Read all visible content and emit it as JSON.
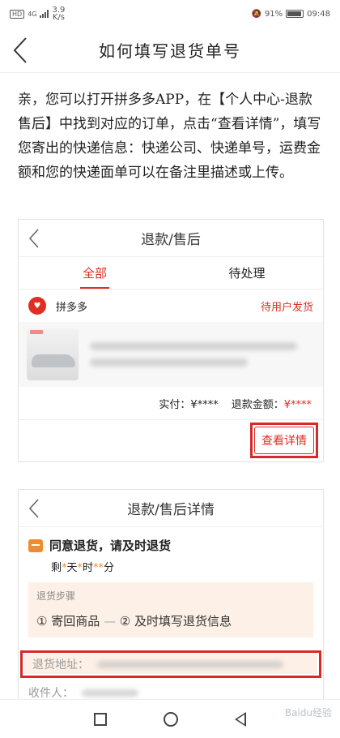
{
  "status_bar": {
    "network": "HD",
    "signal_type": "4G",
    "speed": "3.9",
    "speed_unit": "K/s",
    "battery_pct": "91%",
    "time": "09:48"
  },
  "page": {
    "title": "如何填写退货单号"
  },
  "article": {
    "text": "亲，您可以打开拼多多APP，在【个人中心-退款售后】中找到对应的订单，点击“查看详情”，填写您寄出的快递信息：快递公司、快递单号，运费金额和您的快递面单可以在备注里描述或上传。"
  },
  "shot1": {
    "title": "退款/售后",
    "tabs": [
      "全部",
      "待处理"
    ],
    "shop_name": "拼多多",
    "order_status": "待用户发货",
    "paid_label": "实付：",
    "paid_value": "¥****",
    "refund_label": "退款金额：",
    "refund_value": "¥****",
    "detail_button": "查看详情"
  },
  "shot2": {
    "title": "退款/售后详情",
    "notice_title": "同意退货，请及时退货",
    "countdown": {
      "prefix": "剩",
      "day_unit": "天",
      "hour_unit": "时",
      "min_unit": "分",
      "mask": "*"
    },
    "steps_label": "退货步骤",
    "step1": "① 寄回商品",
    "step_separator": "—",
    "step2": "② 及时填写退货信息",
    "address_label": "退货地址：",
    "receiver_label": "收件人："
  },
  "watermark": "Baidu经验",
  "colors": {
    "accent": "#e02e24",
    "highlight": "#d62a2a",
    "notice_icon": "#f08c2f"
  }
}
